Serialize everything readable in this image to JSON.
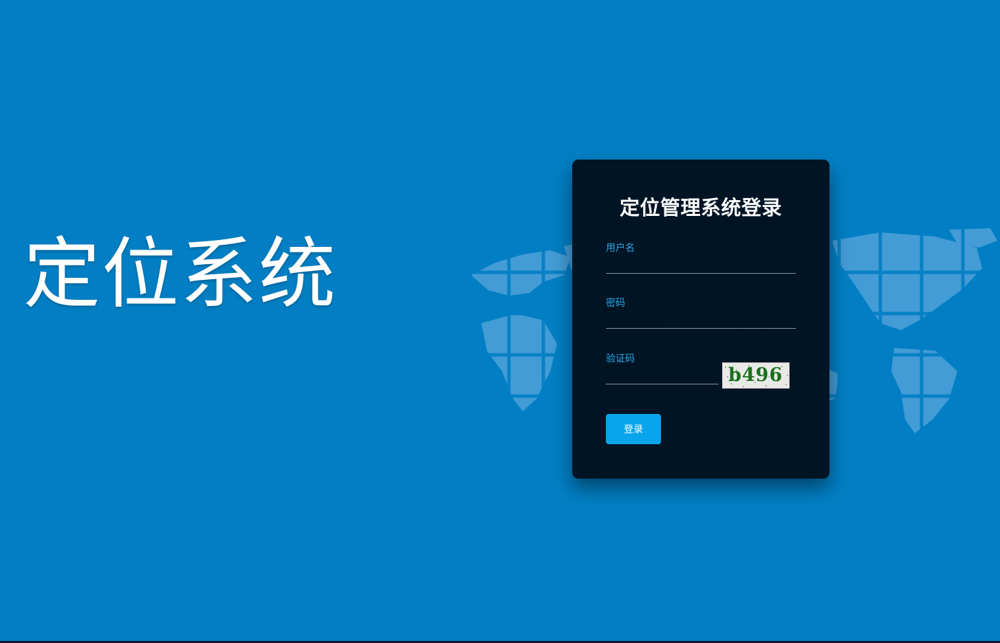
{
  "hero": {
    "title": "定位系统"
  },
  "login_form": {
    "title": "定位管理系统登录",
    "username": {
      "label": "用户名",
      "value": ""
    },
    "password": {
      "label": "密码",
      "value": ""
    },
    "captcha": {
      "label": "验证码",
      "value": "",
      "image_text": "b496"
    },
    "submit_label": "登录"
  },
  "theme": {
    "background": "#027fc4",
    "card_background": "#00101d",
    "label_color": "#2ba7ea",
    "button_color": "#09a5ec",
    "map_color": "#5fa9dd",
    "captcha_text_color": "#17701b"
  }
}
